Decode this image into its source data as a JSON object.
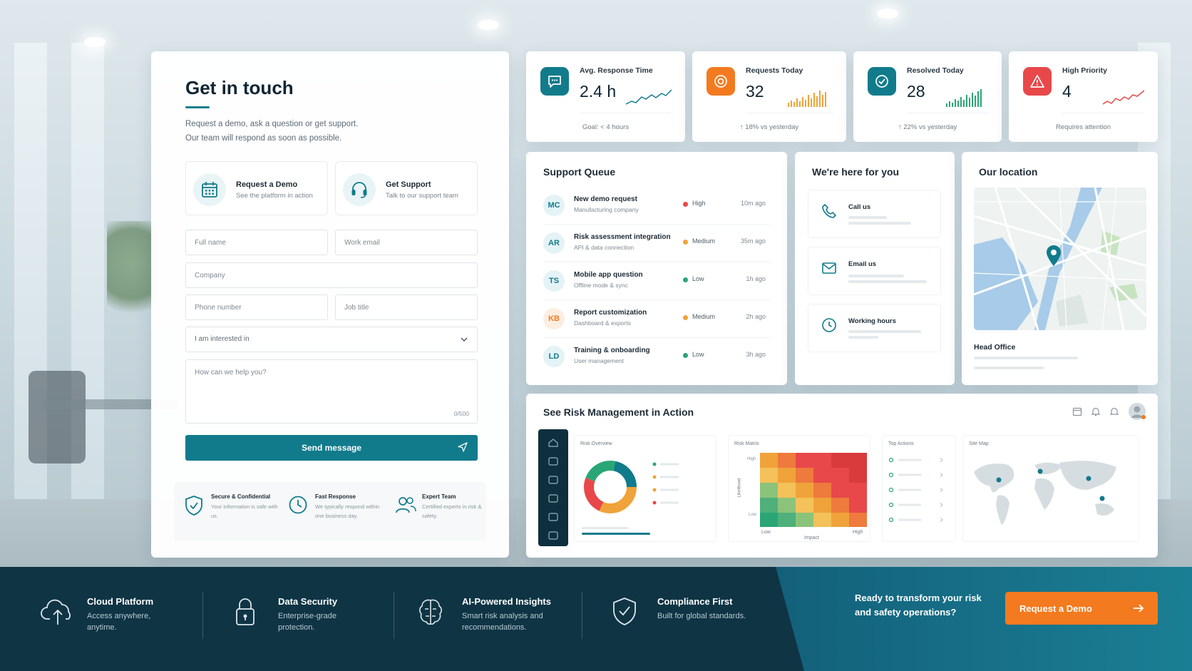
{
  "colors": {
    "teal": "#117b8c",
    "orange": "#f47a1f",
    "red": "#e8484a",
    "navy": "#0f3444",
    "green": "#2aa676",
    "amber": "#f0a33a"
  },
  "form": {
    "title": "Get in touch",
    "subtitle_line1": "Request a demo, ask a question or get support.",
    "subtitle_line2": "Our team will respond as soon as possible.",
    "options": [
      {
        "icon": "calendar-icon",
        "title": "Request a Demo",
        "desc": "See the platform in action"
      },
      {
        "icon": "headset-icon",
        "title": "Get Support",
        "desc": "Talk to our support team"
      }
    ],
    "placeholders": {
      "full_name": "Full name",
      "work_email": "Work email",
      "company": "Company",
      "phone": "Phone number",
      "job_title": "Job title",
      "message": "How can we help you?"
    },
    "interest_label": "I am interested in",
    "counter": "0/500",
    "send_label": "Send message",
    "trust": [
      {
        "icon": "shield-check-icon",
        "title": "Secure & Confidential",
        "desc": "Your information is safe with us."
      },
      {
        "icon": "clock-icon",
        "title": "Fast Response",
        "desc": "We typically respond within one business day."
      },
      {
        "icon": "team-icon",
        "title": "Expert Team",
        "desc": "Certified experts in risk & safety."
      }
    ]
  },
  "stats": [
    {
      "icon": "chat-icon",
      "label": "Avg. Response Time",
      "value": "2.4 h",
      "foot": "Goal: < 4 hours",
      "color": "#117b8c"
    },
    {
      "icon": "target-icon",
      "label": "Requests Today",
      "value": "32",
      "foot": "↑ 18% vs yesterday",
      "color": "#f47a1f"
    },
    {
      "icon": "check-circle-icon",
      "label": "Resolved Today",
      "value": "28",
      "foot": "↑ 22% vs yesterday",
      "color": "#117b8c"
    },
    {
      "icon": "warning-icon",
      "label": "High Priority",
      "value": "4",
      "foot": "Requires attention",
      "color": "#e8484a"
    }
  ],
  "queue": {
    "title": "Support Queue",
    "rows": [
      {
        "initials": "MC",
        "title": "New demo request",
        "sub": "Manufacturing company",
        "priority": "High",
        "time": "10m ago"
      },
      {
        "initials": "AR",
        "title": "Risk assessment integration",
        "sub": "API & data connection",
        "priority": "Medium",
        "time": "35m ago"
      },
      {
        "initials": "TS",
        "title": "Mobile app question",
        "sub": "Offline mode & sync",
        "priority": "Low",
        "time": "1h ago"
      },
      {
        "initials": "KB",
        "title": "Report customization",
        "sub": "Dashboard & exports",
        "priority": "Medium",
        "time": "2h ago"
      },
      {
        "initials": "LD",
        "title": "Training & onboarding",
        "sub": "User management",
        "priority": "Low",
        "time": "3h ago"
      }
    ]
  },
  "here": {
    "title": "We're here for you",
    "items": [
      {
        "icon": "phone-icon",
        "label": "Call us"
      },
      {
        "icon": "mail-icon",
        "label": "Email us"
      },
      {
        "icon": "clock-icon",
        "label": "Working hours"
      }
    ]
  },
  "location": {
    "title": "Our location",
    "name": "Head Office"
  },
  "risk_demo": {
    "title": "See Risk Management in Action",
    "overview_label": "Risk Overview",
    "matrix_label": "Risk Matrix",
    "matrix_y": "Likelihood",
    "matrix_x": "Impact",
    "matrix_low": "Low",
    "matrix_high": "High",
    "matrix_y_high": "High",
    "matrix_y_low": "Low",
    "actions_label": "Top Actions",
    "sitemap_label": "Site Map"
  },
  "bottom": {
    "features": [
      {
        "icon": "cloud-upload-icon",
        "title": "Cloud Platform",
        "desc": "Access anywhere, anytime."
      },
      {
        "icon": "lock-icon",
        "title": "Data Security",
        "desc": "Enterprise-grade protection."
      },
      {
        "icon": "brain-icon",
        "title": "AI-Powered Insights",
        "desc": "Smart risk analysis and recommendations."
      },
      {
        "icon": "shield-check-icon",
        "title": "Compliance First",
        "desc": "Built for global standards."
      }
    ],
    "cta_text": "Ready to transform your risk and safety operations?",
    "cta_button": "Request a Demo"
  }
}
